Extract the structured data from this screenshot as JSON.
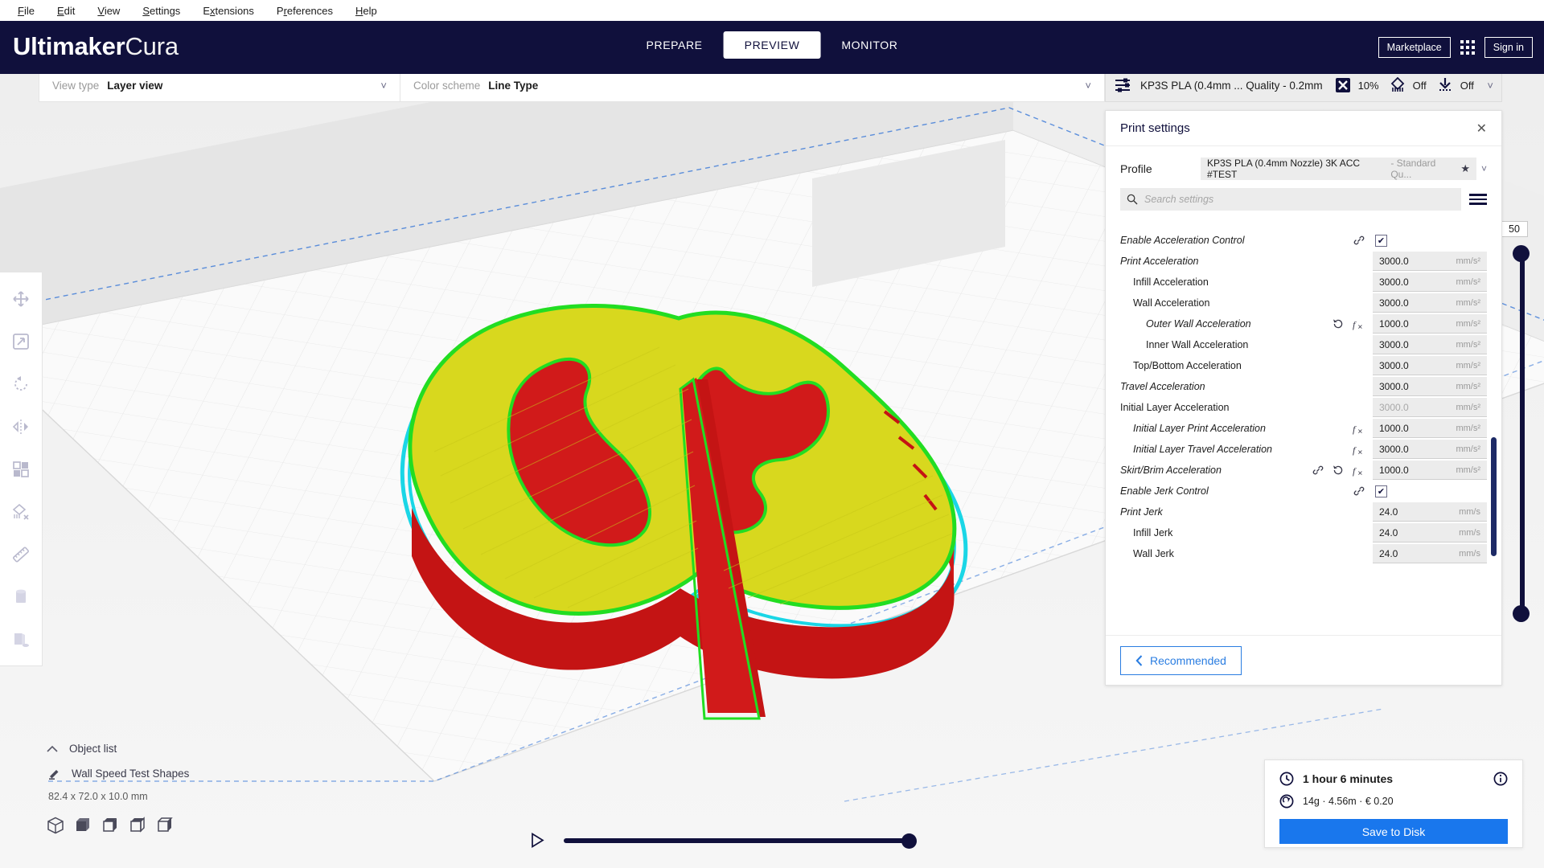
{
  "menubar": [
    "File",
    "Edit",
    "View",
    "Settings",
    "Extensions",
    "Preferences",
    "Help"
  ],
  "header": {
    "logo_bold": "Ultimaker",
    "logo_light": "Cura",
    "tabs": [
      {
        "label": "PREPARE",
        "active": false
      },
      {
        "label": "PREVIEW",
        "active": true
      },
      {
        "label": "MONITOR",
        "active": false
      }
    ],
    "marketplace_label": "Marketplace",
    "signin_label": "Sign in"
  },
  "viewbar": {
    "view_type_label": "View type",
    "view_type_value": "Layer view",
    "color_scheme_label": "Color scheme",
    "color_scheme_value": "Line Type"
  },
  "settings_pill": {
    "profile_summary": "KP3S PLA (0.4mm ... Quality - 0.2mm",
    "infill_value": "10%",
    "support_value": "Off",
    "adhesion_value": "Off"
  },
  "print_settings": {
    "title": "Print settings",
    "profile_label": "Profile",
    "profile_name": "KP3S PLA (0.4mm Nozzle) 3K ACC #TEST",
    "profile_sub": "- Standard Qu...",
    "search_placeholder": "Search settings",
    "search_value": "",
    "recommended_label": "Recommended",
    "rows": [
      {
        "name": "Enable Acceleration Control",
        "indent": 0,
        "italic": true,
        "type": "checkbox",
        "checked": true,
        "icons": [
          "link"
        ]
      },
      {
        "name": "Print Acceleration",
        "indent": 0,
        "italic": true,
        "type": "value",
        "value": "3000.0",
        "unit": "mm/s²",
        "icons": []
      },
      {
        "name": "Infill Acceleration",
        "indent": 1,
        "italic": false,
        "type": "value",
        "value": "3000.0",
        "unit": "mm/s²",
        "icons": []
      },
      {
        "name": "Wall Acceleration",
        "indent": 1,
        "italic": false,
        "type": "value",
        "value": "3000.0",
        "unit": "mm/s²",
        "icons": []
      },
      {
        "name": "Outer Wall Acceleration",
        "indent": 2,
        "italic": true,
        "type": "value",
        "value": "1000.0",
        "unit": "mm/s²",
        "icons": [
          "revert",
          "formula"
        ]
      },
      {
        "name": "Inner Wall Acceleration",
        "indent": 2,
        "italic": false,
        "type": "value",
        "value": "3000.0",
        "unit": "mm/s²",
        "icons": []
      },
      {
        "name": "Top/Bottom Acceleration",
        "indent": 1,
        "italic": false,
        "type": "value",
        "value": "3000.0",
        "unit": "mm/s²",
        "icons": []
      },
      {
        "name": "Travel Acceleration",
        "indent": 0,
        "italic": true,
        "type": "value",
        "value": "3000.0",
        "unit": "mm/s²",
        "icons": []
      },
      {
        "name": "Initial Layer Acceleration",
        "indent": 0,
        "italic": false,
        "type": "value",
        "value": "3000.0",
        "unit": "mm/s²",
        "dim": true,
        "icons": []
      },
      {
        "name": "Initial Layer Print Acceleration",
        "indent": 1,
        "italic": true,
        "type": "value",
        "value": "1000.0",
        "unit": "mm/s²",
        "icons": [
          "formula"
        ]
      },
      {
        "name": "Initial Layer Travel Acceleration",
        "indent": 1,
        "italic": true,
        "type": "value",
        "value": "3000.0",
        "unit": "mm/s²",
        "icons": [
          "formula"
        ]
      },
      {
        "name": "Skirt/Brim Acceleration",
        "indent": 0,
        "italic": true,
        "type": "value",
        "value": "1000.0",
        "unit": "mm/s²",
        "icons": [
          "link",
          "revert",
          "formula"
        ]
      },
      {
        "name": "Enable Jerk Control",
        "indent": 0,
        "italic": true,
        "type": "checkbox",
        "checked": true,
        "icons": [
          "link"
        ]
      },
      {
        "name": "Print Jerk",
        "indent": 0,
        "italic": true,
        "type": "value",
        "value": "24.0",
        "unit": "mm/s",
        "icons": []
      },
      {
        "name": "Infill Jerk",
        "indent": 1,
        "italic": false,
        "type": "value",
        "value": "24.0",
        "unit": "mm/s",
        "icons": []
      },
      {
        "name": "Wall Jerk",
        "indent": 1,
        "italic": false,
        "type": "value",
        "value": "24.0",
        "unit": "mm/s",
        "icons": []
      }
    ]
  },
  "left_tools": [
    "move-icon",
    "scale-icon",
    "rotate-icon",
    "mirror-icon",
    "per-model-settings-icon",
    "support-blocker-icon",
    "measure-icon",
    "cylinder-icon",
    "shape-icon"
  ],
  "object_list": {
    "header": "Object list",
    "item_name": "Wall Speed Test Shapes",
    "dimensions": "82.4 x 72.0 x 10.0 mm"
  },
  "layer_slider": {
    "value": "50"
  },
  "print_info": {
    "time": "1 hour 6 minutes",
    "material": "14g · 4.56m · € 0.20",
    "save_label": "Save to Disk"
  },
  "colors": {
    "header_bg": "#10103c",
    "accent_blue": "#1977ed",
    "recommended_blue": "#2a7de1",
    "viewport_bg": "#f2f2f2",
    "model_infill": "#d8d81e",
    "model_wall": "#e01b1b",
    "model_outline": "#22dd22",
    "model_skirt": "#1ad6e6"
  }
}
